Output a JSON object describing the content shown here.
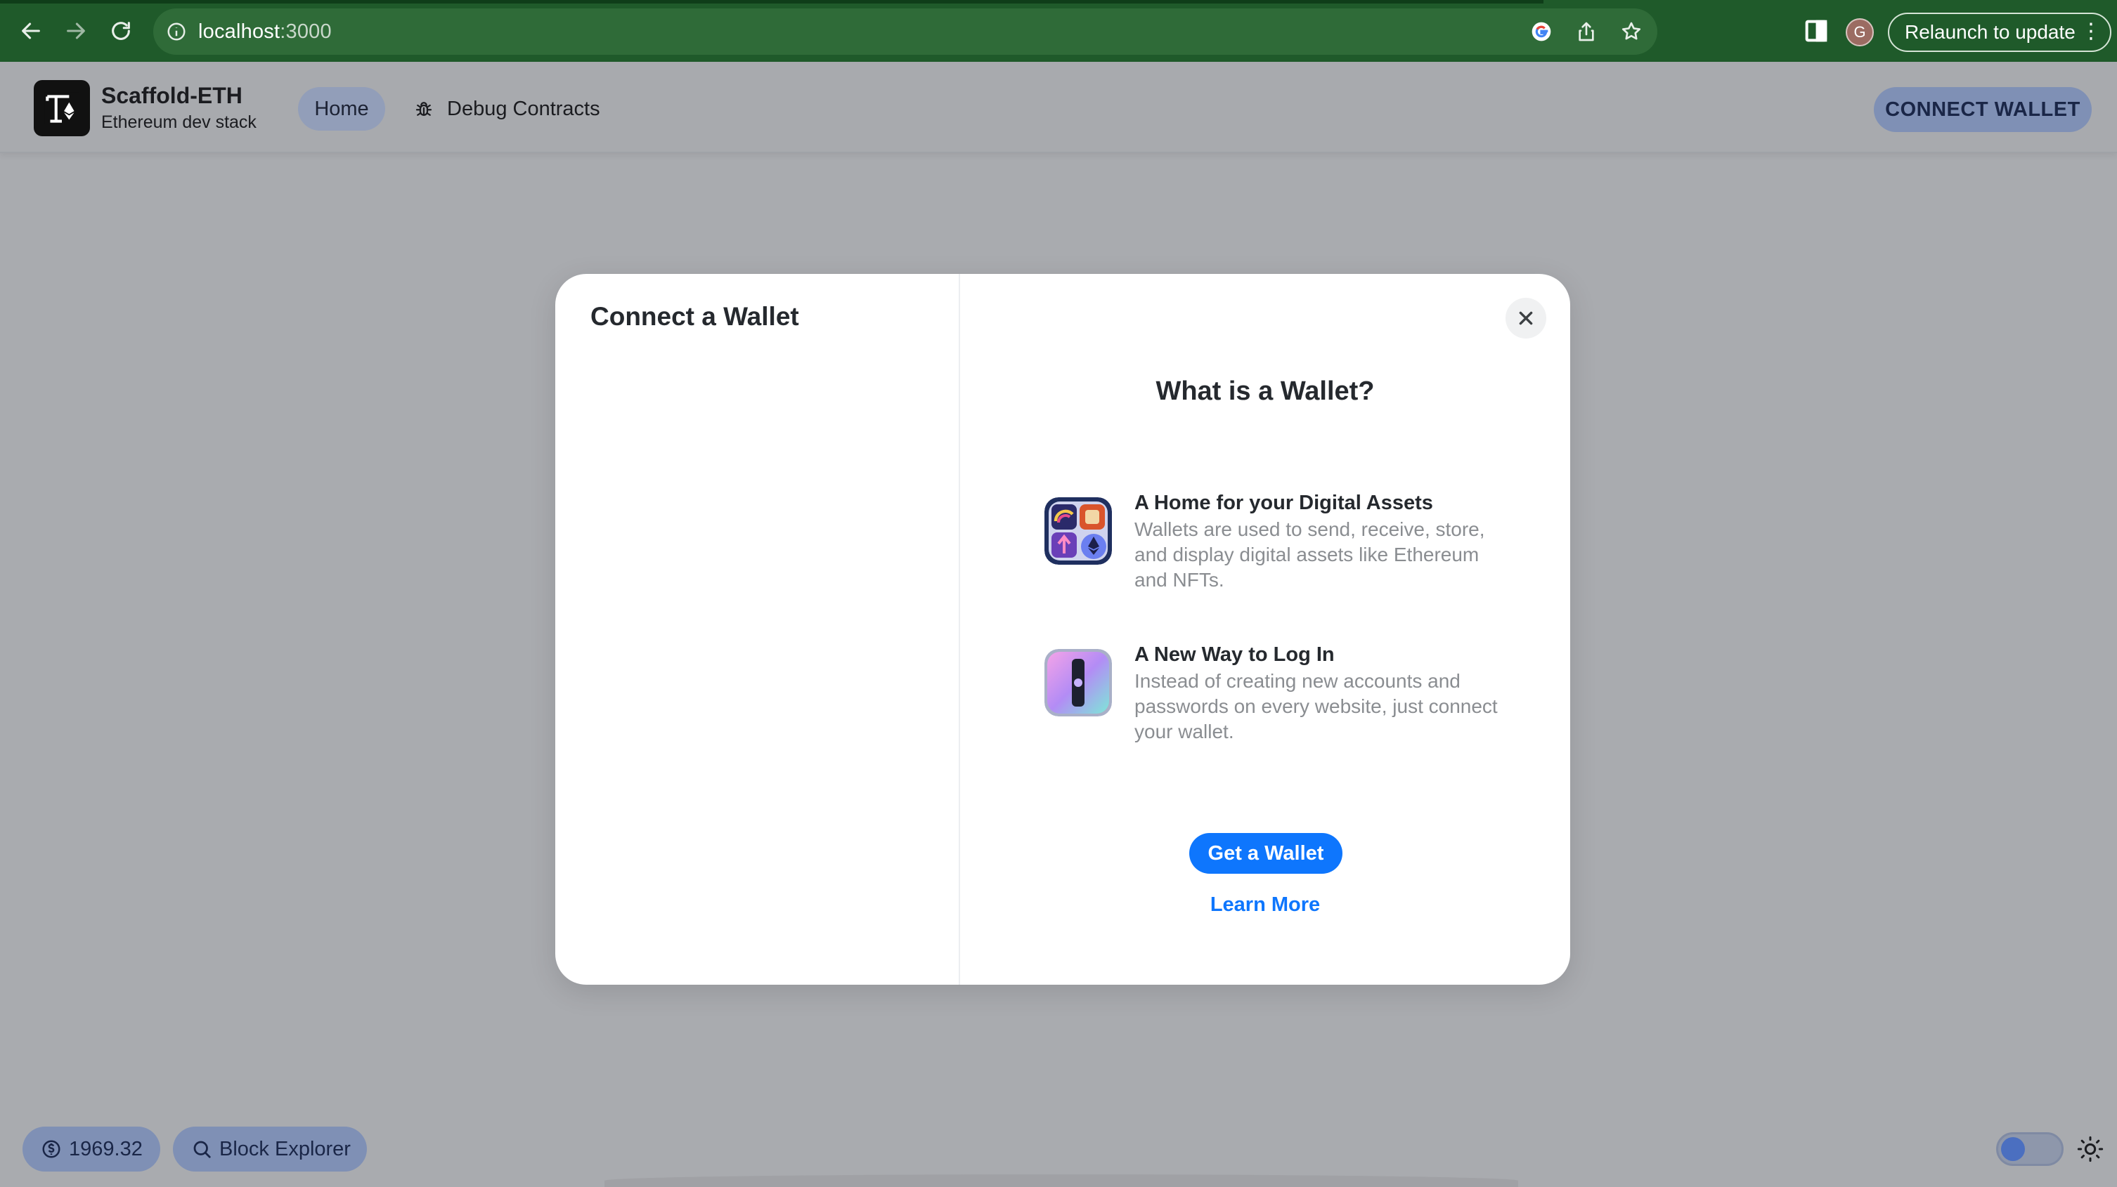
{
  "browser": {
    "url_host": "localhost",
    "url_port": ":3000",
    "profile_initial": "G",
    "relaunch_label": "Relaunch to update"
  },
  "header": {
    "brand_title": "Scaffold-ETH",
    "brand_subtitle": "Ethereum dev stack",
    "nav": {
      "home": "Home",
      "debug": "Debug Contracts"
    },
    "connect_label": "CONNECT WALLET"
  },
  "modal": {
    "title": "Connect a Wallet",
    "info_title": "What is a Wallet?",
    "features": [
      {
        "heading": "A Home for your Digital Assets",
        "description": "Wallets are used to send, receive, store, and display digital assets like Ethereum and NFTs.",
        "icon": "assets-grid-icon"
      },
      {
        "heading": "A New Way to Log In",
        "description": "Instead of creating new accounts and passwords on every website, just connect your wallet.",
        "icon": "keyhole-icon"
      }
    ],
    "get_wallet_label": "Get a Wallet",
    "learn_more_label": "Learn More"
  },
  "footer": {
    "price": "1969.32",
    "block_explorer": "Block Explorer"
  },
  "colors": {
    "browser_bar": "#1f5a2a",
    "overlay_bg": "#a9abaf",
    "accent_blue": "#0e76fd",
    "pill_bg": "#7f90b5"
  }
}
